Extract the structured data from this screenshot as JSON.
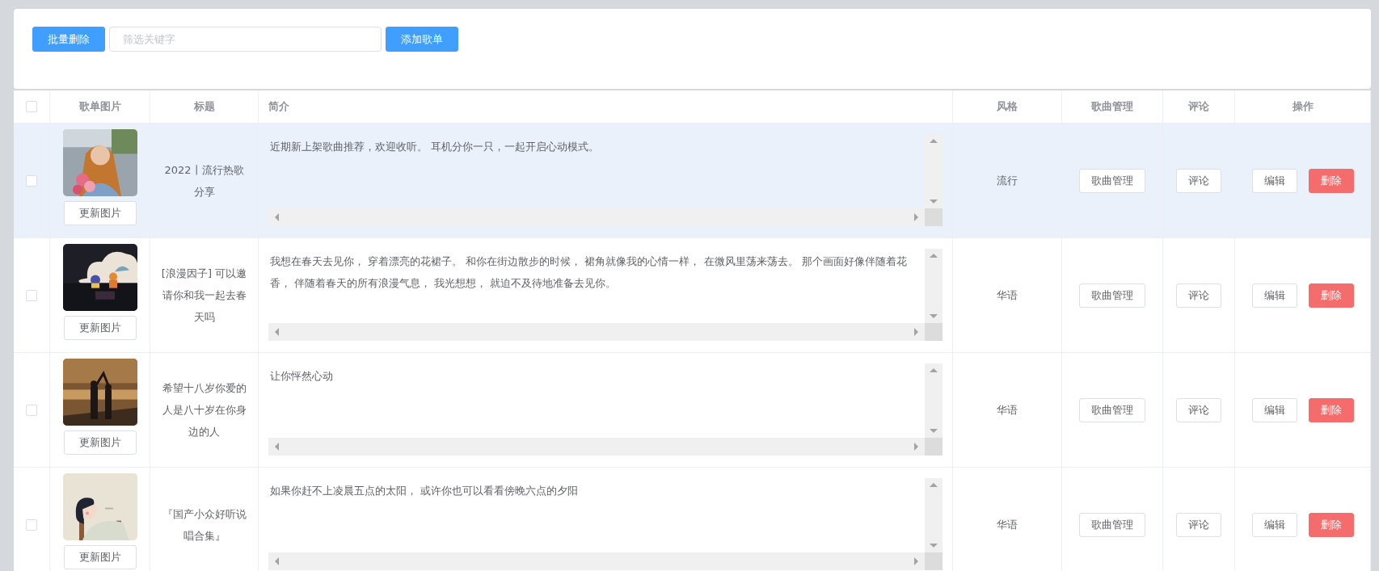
{
  "toolbar": {
    "delete_button": "批量删除",
    "search": {
      "placeholder": "筛选关键字"
    },
    "add_button": "添加歌单"
  },
  "table": {
    "all_checked": false,
    "columns": [
      "歌单图片",
      "标题",
      "简介",
      "风格",
      "歌曲管理",
      "评论",
      "操作"
    ],
    "rows": [
      {
        "checked": false,
        "hovered": true,
        "image_button": "更新图片",
        "title": "2022丨流行热歌分享",
        "description": "近期新上架歌曲推荐，欢迎收听。 耳机分你一只，一起开启心动模式。",
        "style": "流行",
        "manage_button": "歌曲管理",
        "comment_button": "评论",
        "edit_button": "编辑",
        "delete_button": "删除"
      },
      {
        "checked": false,
        "hovered": false,
        "image_button": "更新图片",
        "title": "[浪漫因子] 可以邀请你和我一起去春天吗",
        "description": "我想在春天去见你， 穿着漂亮的花裙子。 和你在街边散步的时候， 裙角就像我的心情一样， 在微风里荡来荡去。 那个画面好像伴随着花香， 伴随着春天的所有浪漫气息， 我光想想， 就迫不及待地准备去见你。",
        "style": "华语",
        "manage_button": "歌曲管理",
        "comment_button": "评论",
        "edit_button": "编辑",
        "delete_button": "删除"
      },
      {
        "checked": false,
        "hovered": false,
        "image_button": "更新图片",
        "title": "希望十八岁你爱的人是八十岁在你身边的人",
        "description": "让你怦然心动",
        "style": "华语",
        "manage_button": "歌曲管理",
        "comment_button": "评论",
        "edit_button": "编辑",
        "delete_button": "删除"
      },
      {
        "checked": false,
        "hovered": false,
        "image_button": "更新图片",
        "title": "『国产小众好听说唱合集』",
        "description": "如果你赶不上凌晨五点的太阳， 或许你也可以看看傍晚六点的夕阳",
        "style": "华语",
        "manage_button": "歌曲管理",
        "comment_button": "评论",
        "edit_button": "编辑",
        "delete_button": "删除"
      }
    ]
  }
}
